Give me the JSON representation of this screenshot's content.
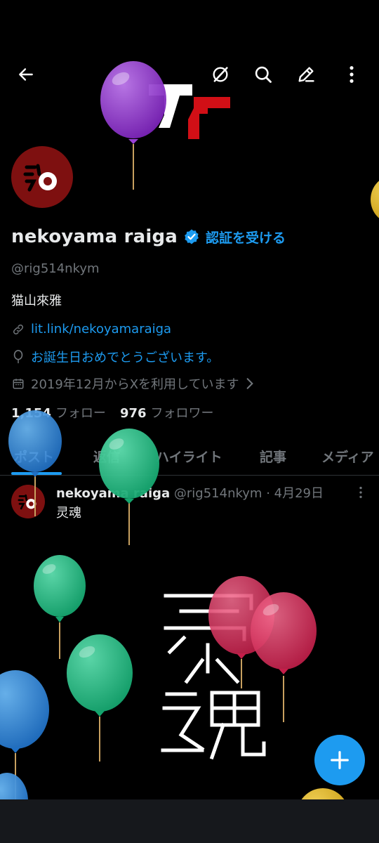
{
  "topbar": {
    "icons": [
      "back-arrow-icon",
      "grok-icon",
      "search-icon",
      "edit-icon",
      "more-vertical-icon"
    ]
  },
  "profile": {
    "display_name": "nekoyama raiga",
    "verified_badge": "verified-badge-icon",
    "get_verified": "認証を受ける",
    "handle": "@rig514nkym",
    "bio": "猫山來雅",
    "link": "lit.link/nekoyamaraiga",
    "birthday": "お誕生日おめでとうございます。",
    "joined": "2019年12月からXを利用しています",
    "following_count": "1,154",
    "following_label": "フォロー",
    "followers_count": "976",
    "followers_label": "フォロワー"
  },
  "tabs": [
    {
      "label": "ポスト",
      "active": true
    },
    {
      "label": "返信",
      "active": false
    },
    {
      "label": "ハイライト",
      "active": false
    },
    {
      "label": "記事",
      "active": false
    },
    {
      "label": "メディア",
      "active": false
    }
  ],
  "post": {
    "author_name": "nekoyama raiga",
    "author_handle": "@rig514nkym",
    "separator": "·",
    "date": "4月29日",
    "text": "灵魂",
    "image_text": "灵魂"
  },
  "fab": {
    "icon": "plus-icon"
  },
  "colors": {
    "accent": "#1d9bf0",
    "background": "#000000",
    "secondary_text": "#71767b",
    "avatar_bg": "#7e1010",
    "logo_red": "#d10f16"
  },
  "decorations": [
    "purple-balloon",
    "blue-balloon",
    "green-balloon",
    "pink-balloon",
    "yellow-balloon"
  ]
}
